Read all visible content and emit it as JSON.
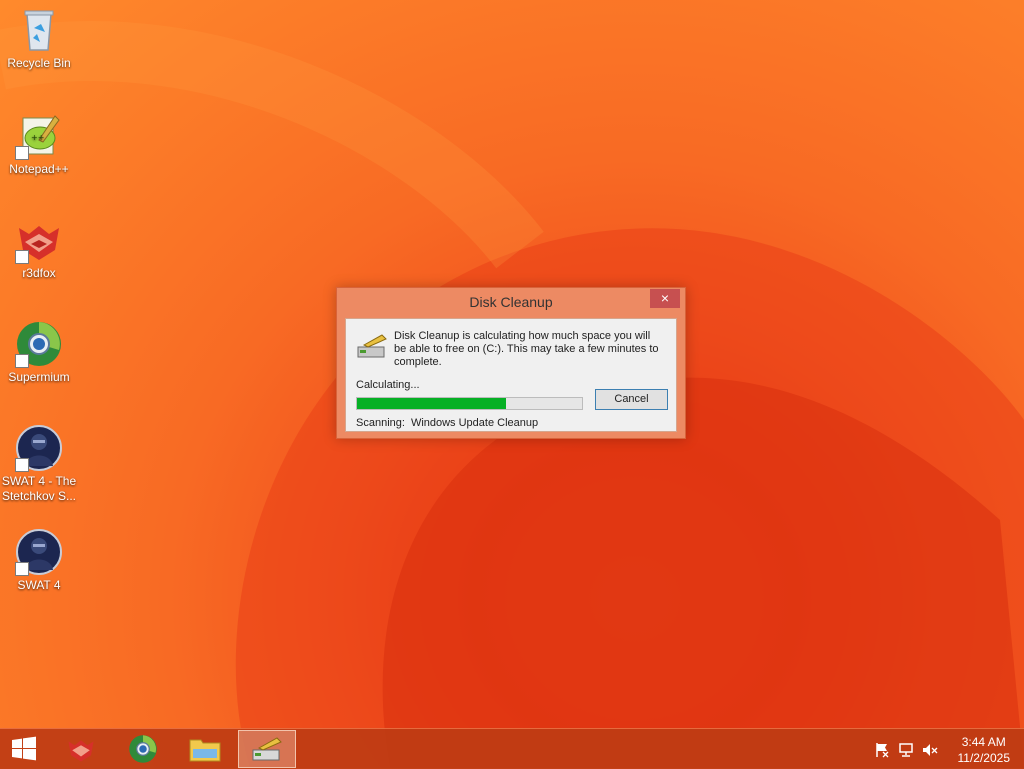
{
  "desktop": {
    "icons": [
      {
        "label": "Recycle Bin",
        "icon": "recycle-bin-icon"
      },
      {
        "label": "Notepad++",
        "icon": "notepad-plus-plus-icon"
      },
      {
        "label": "r3dfox",
        "icon": "r3dfox-icon"
      },
      {
        "label": "Supermium",
        "icon": "supermium-icon"
      },
      {
        "label": "SWAT 4 - The Stetchkov S...",
        "icon": "swat4-stetchkov-icon"
      },
      {
        "label": "SWAT 4",
        "icon": "swat4-icon"
      }
    ]
  },
  "dialog": {
    "title": "Disk Cleanup",
    "close_label": "×",
    "message": "Disk Cleanup is calculating how much space you will be able to free on  (C:). This may take a few minutes to complete.",
    "status": "Calculating...",
    "progress_fraction": 0.66,
    "cancel_label": "Cancel",
    "scanning_label": "Scanning:",
    "scanning_item": "Windows Update Cleanup"
  },
  "taskbar": {
    "start_icon": "windows-start-icon",
    "pinned": [
      "r3dfox-icon",
      "supermium-icon",
      "file-explorer-icon",
      "disk-cleanup-icon"
    ],
    "active": "disk-cleanup-icon",
    "tray_icons": [
      "action-center-flag-icon",
      "network-icon",
      "volume-muted-icon"
    ],
    "time": "3:44 AM",
    "date": "11/2/2025"
  },
  "colors": {
    "accent": "#f06a25",
    "progress": "#06b025",
    "close": "#c75050"
  }
}
